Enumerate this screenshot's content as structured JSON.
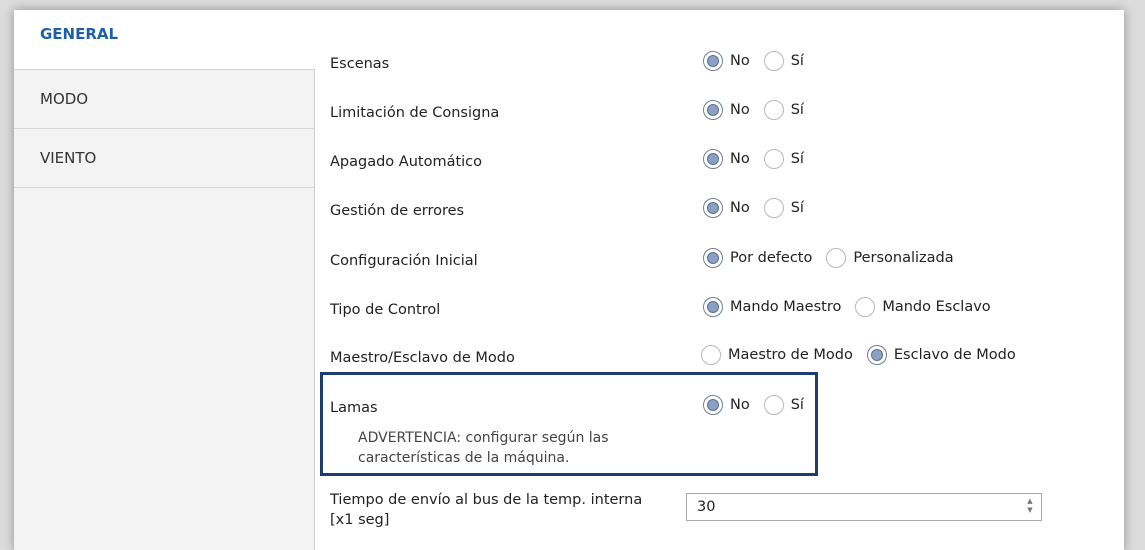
{
  "sidebar": {
    "items": [
      {
        "label": "GENERAL",
        "active": true
      },
      {
        "label": "MODO",
        "active": false
      },
      {
        "label": "VIENTO",
        "active": false
      }
    ]
  },
  "params": [
    {
      "label": "Escenas",
      "options": [
        "No",
        "Sí"
      ],
      "selected": 0
    },
    {
      "label": "Limitación de Consigna",
      "options": [
        "No",
        "Sí"
      ],
      "selected": 0
    },
    {
      "label": "Apagado Automático",
      "options": [
        "No",
        "Sí"
      ],
      "selected": 0
    },
    {
      "label": "Gestión de errores",
      "options": [
        "No",
        "Sí"
      ],
      "selected": 0
    },
    {
      "label": "Configuración Inicial",
      "options": [
        "Por defecto",
        "Personalizada"
      ],
      "selected": 0
    },
    {
      "label": "Tipo de Control",
      "options": [
        "Mando Maestro",
        "Mando Esclavo"
      ],
      "selected": 0
    },
    {
      "label": "Maestro/Esclavo de Modo",
      "options": [
        "Maestro de Modo",
        "Esclavo de Modo"
      ],
      "selected": 1
    },
    {
      "label": "Lamas",
      "options": [
        "No",
        "Sí"
      ],
      "selected": 0
    }
  ],
  "warning": "ADVERTENCIA: configurar según las características de la máquina.",
  "time_param": {
    "label": "Tiempo de envío al bus de la temp. interna [x1 seg]",
    "value": "30"
  },
  "colors": {
    "active_tab": "#1f5fa8",
    "highlight_border": "#1c3d6e",
    "radio_fill": "#8aa0c4"
  }
}
